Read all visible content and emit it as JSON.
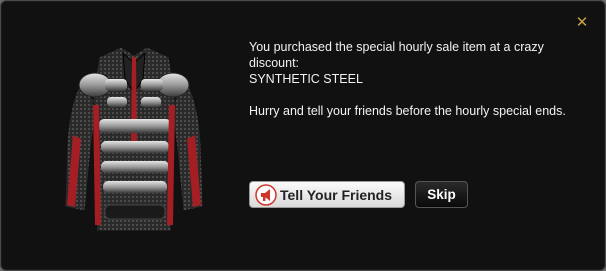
{
  "dialog": {
    "close_icon": "close-x-icon",
    "item_image": "synthetic-steel-jacket",
    "message_line1": "You purchased the special hourly sale item at a crazy discount:",
    "item_name": "SYNTHETIC STEEL",
    "message_line2": "Hurry and tell your friends before the hourly special ends.",
    "tell_friends_label": "Tell Your Friends",
    "tell_friends_icon": "megaphone-icon",
    "skip_label": "Skip"
  },
  "colors": {
    "background": "#111111",
    "close_icon": "#c8a24a",
    "accent_red": "#a51e24"
  }
}
